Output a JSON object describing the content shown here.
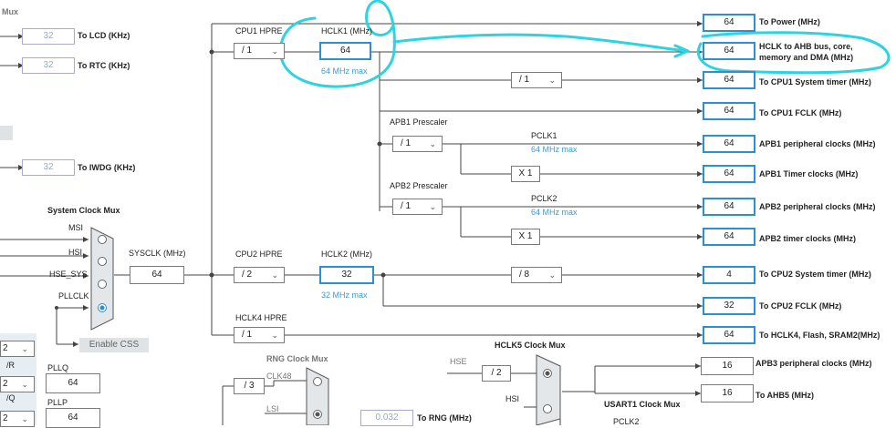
{
  "left": {
    "mux_title": "Mux",
    "lcd": {
      "value": "32",
      "label": "To LCD (KHz)"
    },
    "rtc": {
      "value": "32",
      "label": "To RTC (KHz)"
    },
    "iwdg": {
      "value": "32",
      "label": "To IWDG (KHz)"
    },
    "sys_clock_mux_title": "System Clock Mux",
    "mux_inputs": [
      "MSI",
      "HSI",
      "HSE_SYS",
      "PLLCLK"
    ],
    "sysclk_label": "SYSCLK (MHz)",
    "sysclk_value": "64",
    "enable_css": "Enable CSS",
    "pllr_value": "2",
    "pllr_label": "/R",
    "pllq_value": "2",
    "pllq_label": "/Q",
    "pllq_title": "PLLQ",
    "pllq_box": "64",
    "pllp_value": "2",
    "pllp_title": "PLLP",
    "pllp_box": "64"
  },
  "cpu1": {
    "hpre_label": "CPU1 HPRE",
    "hpre_value": "/ 1",
    "hclk1_label": "HCLK1 (MHz)",
    "hclk1_value": "64",
    "hclk1_max": "64 MHz max"
  },
  "cpu2": {
    "hpre_label": "CPU2 HPRE",
    "hpre_value": "/ 2",
    "hclk2_label": "HCLK2 (MHz)",
    "hclk2_value": "32",
    "hclk2_max": "32 MHz max",
    "systimer_div": "/ 8"
  },
  "hclk4": {
    "hpre_label": "HCLK4 HPRE",
    "hpre_value": "/ 1"
  },
  "systimer_div": "/ 1",
  "apb1": {
    "prescaler_label": "APB1 Prescaler",
    "prescaler_value": "/ 1",
    "pclk_label": "PCLK1",
    "pclk_max": "64 MHz max",
    "timer_mult": "X 1"
  },
  "apb2": {
    "prescaler_label": "APB2 Prescaler",
    "prescaler_value": "/ 1",
    "pclk_label": "PCLK2",
    "pclk_max": "64 MHz max",
    "timer_mult": "X 1"
  },
  "outputs": [
    {
      "value": "64",
      "label": "To Power (MHz)"
    },
    {
      "value": "64",
      "label": "HCLK to AHB bus, core,",
      "label2": "memory and DMA (MHz)"
    },
    {
      "value": "64",
      "label": "To CPU1 System timer (MHz)"
    },
    {
      "value": "64",
      "label": "To CPU1 FCLK (MHz)"
    },
    {
      "value": "64",
      "label": "APB1 peripheral clocks (MHz)"
    },
    {
      "value": "64",
      "label": "APB1 Timer clocks (MHz)"
    },
    {
      "value": "64",
      "label": "APB2 peripheral clocks (MHz)"
    },
    {
      "value": "64",
      "label": "APB2 timer clocks (MHz)"
    },
    {
      "value": "4",
      "label": "To CPU2 System timer (MHz)"
    },
    {
      "value": "32",
      "label": "To CPU2 FCLK (MHz)"
    },
    {
      "value": "64",
      "label": "To HCLK4, Flash, SRAM2(MHz)"
    },
    {
      "value": "16",
      "label": "APB3 peripheral clocks (MHz)"
    },
    {
      "value": "16",
      "label": "To AHB5 (MHz)"
    }
  ],
  "rng": {
    "title": "RNG Clock Mux",
    "div": "/ 3",
    "in1": "CLK48",
    "in2": "LSI",
    "value": "0.032",
    "label": "To RNG (MHz)"
  },
  "hclk5": {
    "title": "HCLK5 Clock Mux",
    "in1": "HSE",
    "div": "/ 2",
    "in2": "HSI"
  },
  "usart1": {
    "title": "USART1 Clock Mux",
    "pclk2": "PCLK2"
  },
  "annotation_color": "#2ed3e0"
}
